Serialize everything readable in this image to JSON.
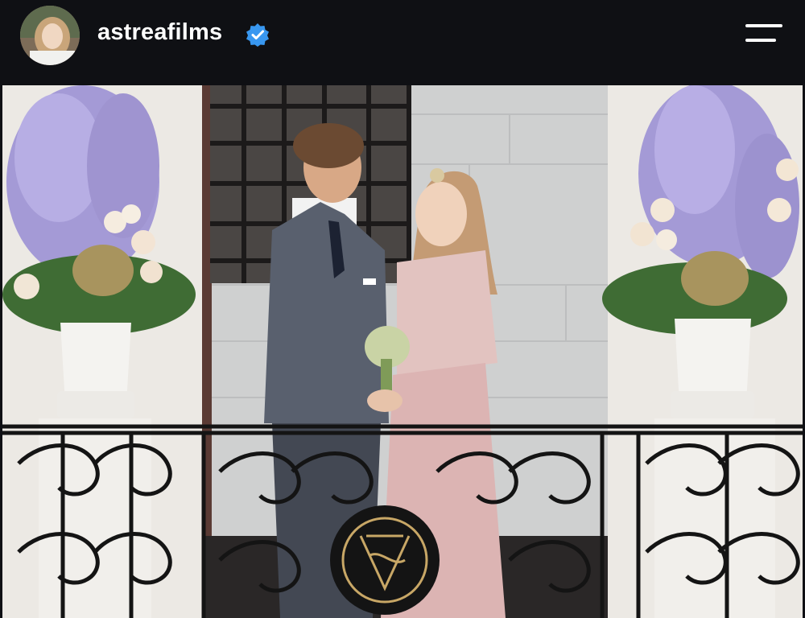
{
  "header": {
    "username": "astreafilms",
    "verified": true,
    "avatar_icon": "profile-avatar",
    "verified_icon": "verified-badge-icon",
    "menu_icon": "hamburger-menu-icon"
  },
  "post": {
    "image_icon": "wedding-photo",
    "colors": {
      "background": "#0f1014",
      "verified_blue": "#3897f0",
      "dress_pink": "#dcb4b3",
      "suit_grey": "#59606e"
    }
  }
}
